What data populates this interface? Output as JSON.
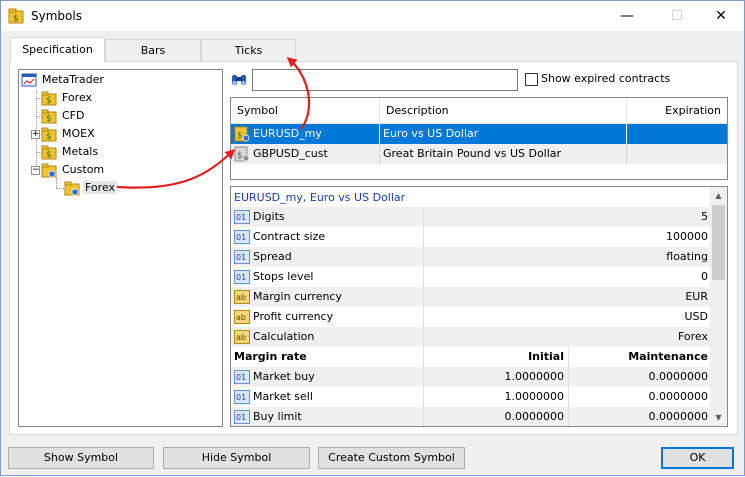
{
  "window": {
    "title": "Symbols",
    "minimize_glyph": "—",
    "maximize_glyph": "☐",
    "close_glyph": "✕"
  },
  "tabs": [
    {
      "label": "Specification",
      "active": true
    },
    {
      "label": "Bars",
      "active": false
    },
    {
      "label": "Ticks",
      "active": false
    }
  ],
  "tree": {
    "root": "MetaTrader",
    "items": [
      {
        "label": "Forex",
        "icon": "folder-dollar-icon"
      },
      {
        "label": "CFD",
        "icon": "folder-dollar-icon"
      },
      {
        "label": "MOEX",
        "icon": "folder-dollar-icon",
        "expander": "+"
      },
      {
        "label": "Metals",
        "icon": "folder-dollar-icon"
      },
      {
        "label": "Custom",
        "icon": "folder-gear-icon",
        "expander": "−"
      }
    ],
    "child": {
      "label": "Forex",
      "icon": "folder-gear-icon",
      "selected": true
    }
  },
  "search": {
    "value": "",
    "placeholder": "",
    "show_expired_label": "Show expired contracts",
    "show_expired_checked": false
  },
  "symbols": {
    "headers": [
      "Symbol",
      "Description",
      "Expiration"
    ],
    "rows": [
      {
        "symbol": "EURUSD_my",
        "description": "Euro vs US Dollar",
        "expiration": "",
        "selected": true
      },
      {
        "symbol": "GBPUSD_cust",
        "description": "Great Britain Pound vs US Dollar",
        "expiration": "",
        "selected": false
      }
    ]
  },
  "properties": {
    "title": "EURUSD_my, Euro vs US Dollar",
    "rows": [
      {
        "name": "Digits",
        "value": "5",
        "type": "01"
      },
      {
        "name": "Contract size",
        "value": "100000",
        "type": "01"
      },
      {
        "name": "Spread",
        "value": "floating",
        "type": "01"
      },
      {
        "name": "Stops level",
        "value": "0",
        "type": "01"
      },
      {
        "name": "Margin currency",
        "value": "EUR",
        "type": "ab"
      },
      {
        "name": "Profit currency",
        "value": "USD",
        "type": "ab"
      },
      {
        "name": "Calculation",
        "value": "Forex",
        "type": "ab"
      }
    ],
    "margin_header": {
      "name": "Margin rate",
      "initial": "Initial",
      "maintenance": "Maintenance"
    },
    "margin_rows": [
      {
        "name": "Market buy",
        "initial": "1.0000000",
        "maintenance": "0.0000000"
      },
      {
        "name": "Market sell",
        "initial": "1.0000000",
        "maintenance": "0.0000000"
      },
      {
        "name": "Buy limit",
        "initial": "0.0000000",
        "maintenance": "0.0000000"
      }
    ]
  },
  "buttons": {
    "show_symbol": "Show Symbol",
    "hide_symbol": "Hide Symbol",
    "create_custom_symbol": "Create Custom Symbol",
    "ok": "OK"
  },
  "colors": {
    "selection": "#0078d7",
    "arrow": "#e02020",
    "link_title": "#1c3fa8"
  }
}
